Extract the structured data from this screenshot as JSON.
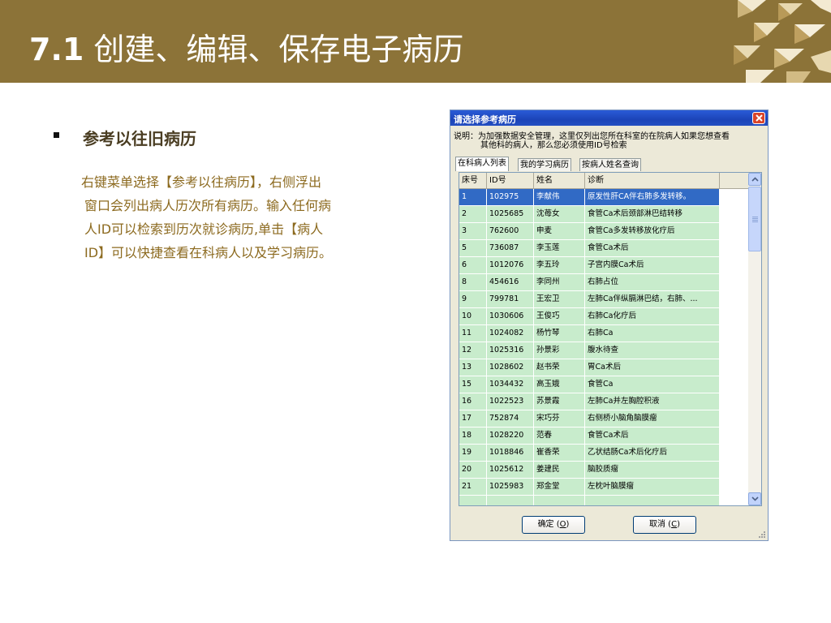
{
  "slide": {
    "number": "7.1",
    "title": "创建、编辑、保存电子病历",
    "subtitle": "参考以往旧病历",
    "paragraph_lines": [
      "右键菜单选择【参考以往病历】，右侧浮出",
      "窗口会列出病人历次所有病历。输入任何病",
      "人ID可以检索到历次就诊病历,单击【病人",
      "ID】可以快捷查看在科病人以及学习病历。"
    ]
  },
  "dialog": {
    "title": "请选择参考病历",
    "note_line1": "说明：为加强数据安全管理，这里仅列出您所在科室的在院病人如果您想查看",
    "note_line2": "其他科的病人，那么您必须使用ID号检索",
    "tabs": [
      "在科病人列表",
      "我的学习病历",
      "按病人姓名查询"
    ],
    "columns": [
      "床号",
      "ID号",
      "姓名",
      "诊断"
    ],
    "rows": [
      {
        "bed": "1",
        "id": "102975",
        "name": "李献伟",
        "diag": "原发性肝CA伴右肺多发转移。"
      },
      {
        "bed": "2",
        "id": "1025685",
        "name": "沈苺女",
        "diag": "食管Ca术后颈部淋巴结转移"
      },
      {
        "bed": "3",
        "id": "762600",
        "name": "申麦",
        "diag": "食管Ca多发转移放化疗后"
      },
      {
        "bed": "5",
        "id": "736087",
        "name": "李玉莲",
        "diag": "食管Ca术后"
      },
      {
        "bed": "6",
        "id": "1012076",
        "name": "李五玲",
        "diag": "子宫内膜Ca术后"
      },
      {
        "bed": "8",
        "id": "454616",
        "name": "李同州",
        "diag": "右肺占位"
      },
      {
        "bed": "9",
        "id": "799781",
        "name": "王宏卫",
        "diag": "左肺Ca伴纵膈淋巴结，右肺、..."
      },
      {
        "bed": "10",
        "id": "1030606",
        "name": "王俊巧",
        "diag": "右肺Ca化疗后"
      },
      {
        "bed": "11",
        "id": "1024082",
        "name": "杨竹琴",
        "diag": "右肺Ca"
      },
      {
        "bed": "12",
        "id": "1025316",
        "name": "孙景彩",
        "diag": "腹水待查"
      },
      {
        "bed": "13",
        "id": "1028602",
        "name": "赵书荣",
        "diag": "胃Ca术后"
      },
      {
        "bed": "15",
        "id": "1034432",
        "name": "高玉娥",
        "diag": "食管Ca"
      },
      {
        "bed": "16",
        "id": "1022523",
        "name": "苏景霞",
        "diag": "左肺Ca并左胸腔积液"
      },
      {
        "bed": "17",
        "id": "752874",
        "name": "宋巧芬",
        "diag": "右侧桥小脑角脑膜瘤"
      },
      {
        "bed": "18",
        "id": "1028220",
        "name": "范春",
        "diag": "食管Ca术后"
      },
      {
        "bed": "19",
        "id": "1018846",
        "name": "崔香荣",
        "diag": "乙状结肠Ca术后化疗后"
      },
      {
        "bed": "20",
        "id": "1025612",
        "name": "姜建民",
        "diag": "脑胶质瘤"
      },
      {
        "bed": "21",
        "id": "1025983",
        "name": "郑金堂",
        "diag": "左枕叶脑膜瘤"
      },
      {
        "bed": "",
        "id": "",
        "name": "",
        "diag": ""
      }
    ],
    "selected_row": 0,
    "ok_label": "确定",
    "ok_key": "O",
    "cancel_label": "取消",
    "cancel_key": "C"
  },
  "colors": {
    "header_bg": "#8c7338",
    "row_bg": "#c8eccc",
    "selected_bg": "#316ac5",
    "paragraph_text": "#8c6a1f"
  }
}
